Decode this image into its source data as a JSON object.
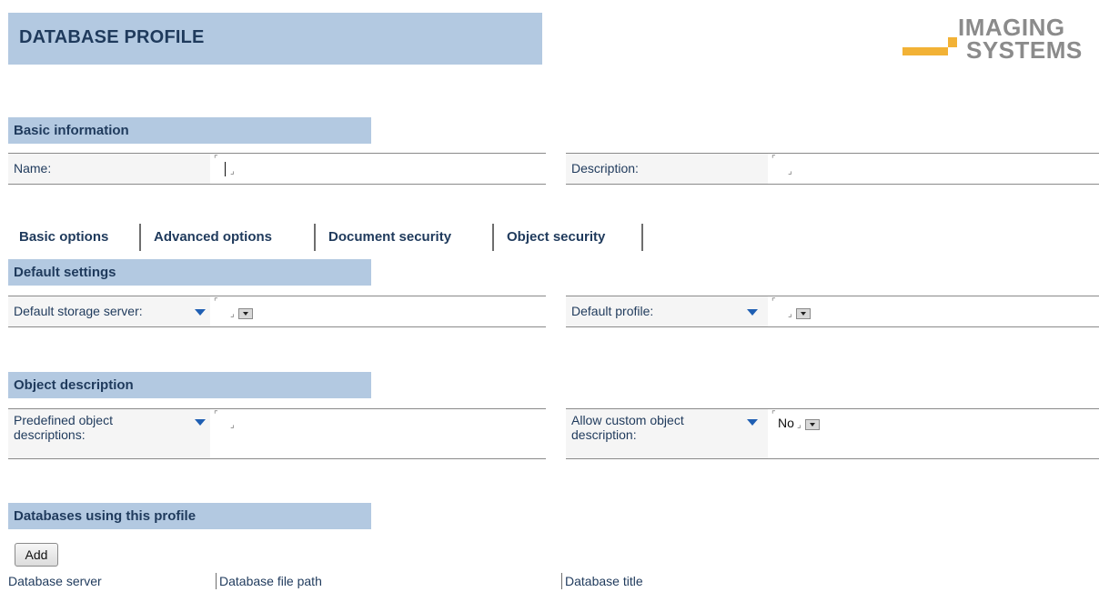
{
  "page": {
    "title": "DATABASE PROFILE"
  },
  "logo": {
    "line1": "IMAGING",
    "line2": "SYSTEMS"
  },
  "sections": {
    "basic": "Basic information",
    "defaults": "Default settings",
    "object": "Object description",
    "databases": "Databases using this profile"
  },
  "basic_info": {
    "name_label": "Name:",
    "name_value": "",
    "description_label": "Description:",
    "description_value": ""
  },
  "tabs": [
    {
      "label": "Basic options",
      "active": true
    },
    {
      "label": "Advanced options",
      "active": false
    },
    {
      "label": "Document security",
      "active": false
    },
    {
      "label": "Object security",
      "active": false
    }
  ],
  "default_settings": {
    "storage_label": "Default storage server:",
    "storage_value": "",
    "profile_label": "Default profile:",
    "profile_value": ""
  },
  "object_description": {
    "predefined_label": "Predefined object descriptions:",
    "predefined_value": "",
    "custom_label": "Allow custom object description:",
    "custom_value": "No"
  },
  "databases": {
    "add_label": "Add",
    "columns": [
      "Database server",
      "Database file path",
      "Database title"
    ]
  },
  "icons": {
    "dropdown_arrow": "dropdown-arrow-icon",
    "select_button": "select-button-icon",
    "field_bracket": "field-bracket-icon"
  },
  "colors": {
    "banner": "#b3c9e1",
    "heading_text": "#1f3a5c",
    "arrow_blue": "#1f5fb3",
    "logo_gray": "#8b8b8b",
    "logo_orange": "#f2b236"
  }
}
